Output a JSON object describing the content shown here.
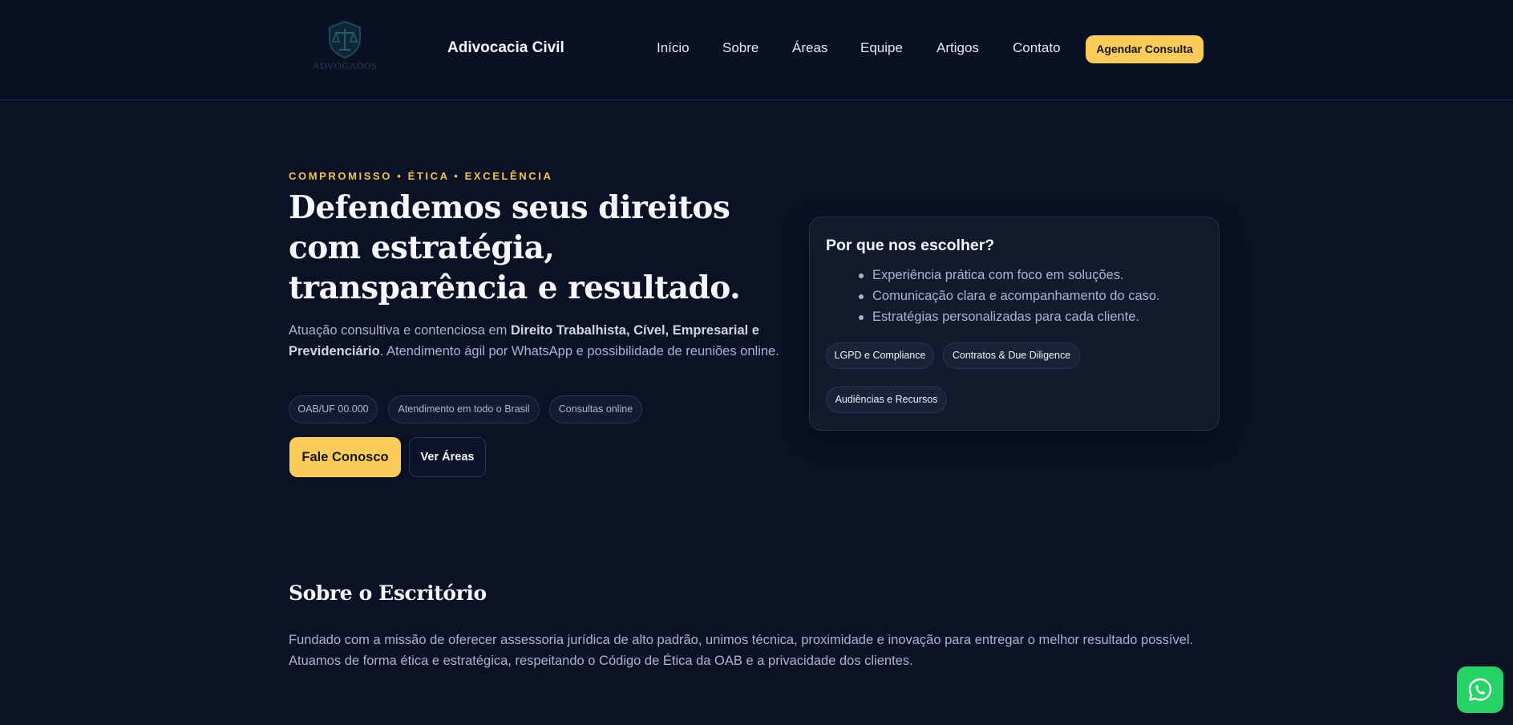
{
  "header": {
    "logo_text": "ADVOGADOS",
    "brand": "Adivocacia Civil",
    "nav": [
      "Início",
      "Sobre",
      "Áreas",
      "Equipe",
      "Artigos",
      "Contato"
    ],
    "cta": "Agendar Consulta"
  },
  "hero": {
    "eyebrow": "COMPROMISSO • ÉTICA • EXCELÊNCIA",
    "title": "Defendemos seus direitos com estratégia, transparência e resultado.",
    "desc_before": "Atuação consultiva e contenciosa em ",
    "desc_bold": "Direito Trabalhista, Cível, Empresarial e Previdenciário",
    "desc_after": ". Atendimento ágil por WhatsApp e possibilidade de reuniões online.",
    "chips": [
      "OAB/UF 00.000",
      "Atendimento em todo o Brasil",
      "Consultas online"
    ],
    "primary_button": "Fale Conosco",
    "secondary_button": "Ver Áreas"
  },
  "why_card": {
    "title": "Por que nos escolher?",
    "items": [
      "Experiência prática com foco em soluções.",
      "Comunicação clara e acompanhamento do caso.",
      "Estratégias personalizadas para cada cliente."
    ],
    "tags": [
      "LGPD e Compliance",
      "Contratos & Due Diligence",
      "Audiências e Recursos"
    ]
  },
  "about": {
    "title": "Sobre o Escritório",
    "text": "Fundado com a missão de oferecer assessoria jurídica de alto padrão, unimos técnica, proximidade e inovação para entregar o melhor resultado possível. Atuamos de forma ética e estratégica, respeitando o Código de Ética da OAB e a privacidade dos clientes."
  },
  "floating": {
    "icon": "whatsapp-icon"
  },
  "colors": {
    "background": "#0b1226",
    "accent": "#fccc5b",
    "eyebrow": "#f6c14f",
    "whatsapp": "#25d366"
  }
}
